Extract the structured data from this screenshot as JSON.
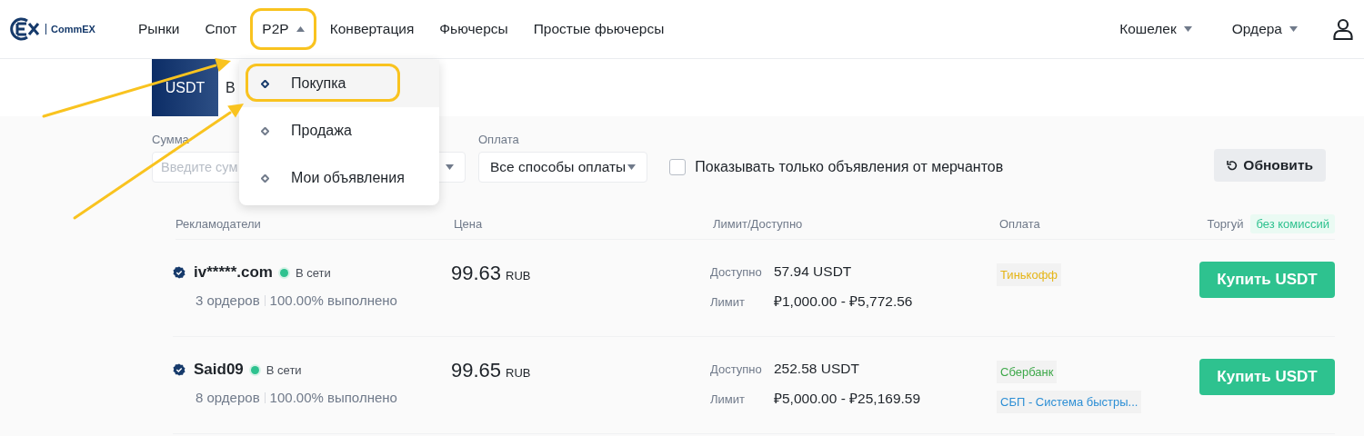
{
  "header": {
    "logo": "CommEX",
    "nav": [
      {
        "label": "Рынки",
        "kind": "link"
      },
      {
        "label": "Спот",
        "kind": "link"
      },
      {
        "label": "P2P",
        "kind": "dropdown",
        "expanded": true,
        "highlighted": true
      },
      {
        "label": "Конвертация",
        "kind": "link"
      },
      {
        "label": "Фьючерсы",
        "kind": "link"
      },
      {
        "label": "Простые фьючерсы",
        "kind": "link"
      }
    ],
    "right": [
      {
        "label": "Кошелек",
        "expanded": false
      },
      {
        "label": "Ордера",
        "expanded": false
      }
    ]
  },
  "p2p_menu": [
    {
      "label": "Покупка",
      "selected": true,
      "highlighted": true
    },
    {
      "label": "Продажа",
      "selected": false,
      "highlighted": false
    },
    {
      "label": "Мои объявления",
      "selected": false,
      "highlighted": false
    }
  ],
  "asset_tabs": [
    {
      "label": "USDT",
      "selected": true
    },
    {
      "label": "B",
      "selected": false
    }
  ],
  "filters": {
    "amount": {
      "label": "Сумма",
      "placeholder": "Введите сум"
    },
    "payment": {
      "label": "Оплата",
      "value": "Все способы оплаты"
    },
    "merchants_only": {
      "label": "Показывать только объявления от мерчантов",
      "checked": false
    },
    "refresh_button": "Обновить"
  },
  "table": {
    "columns": [
      "Рекламодатели",
      "Цена",
      "Лимит/Доступно",
      "Оплата",
      "Торгуй"
    ],
    "fee_badge": "без комиссий",
    "rows": [
      {
        "name": "iv*****.com",
        "verified": true,
        "online": true,
        "status": "В сети",
        "orders": "3 ордеров",
        "completion": "100.00% выполнено",
        "price": "99.63",
        "currency": "RUB",
        "available_label": "Доступно",
        "available": "57.94 USDT",
        "limit_label": "Лимит",
        "limit": "₽1,000.00 - ₽5,772.56",
        "payments": [
          {
            "name": "Тинькофф",
            "color": "#e5b517"
          }
        ],
        "action": "Купить USDT"
      },
      {
        "name": "Said09",
        "verified": true,
        "online": true,
        "status": "В сети",
        "orders": "8 ордеров",
        "completion": "100.00% выполнено",
        "price": "99.65",
        "currency": "RUB",
        "available_label": "Доступно",
        "available": "252.58 USDT",
        "limit_label": "Лимит",
        "limit": "₽5,000.00 - ₽25,169.59",
        "payments": [
          {
            "name": "Сбербанк",
            "color": "#3ea84a"
          },
          {
            "name": "СБП - Система быстры...",
            "color": "#2d8fd5"
          }
        ],
        "action": "Купить USDT"
      }
    ]
  },
  "annotations": [
    {
      "kind": "arrow"
    },
    {
      "kind": "arrow"
    }
  ]
}
